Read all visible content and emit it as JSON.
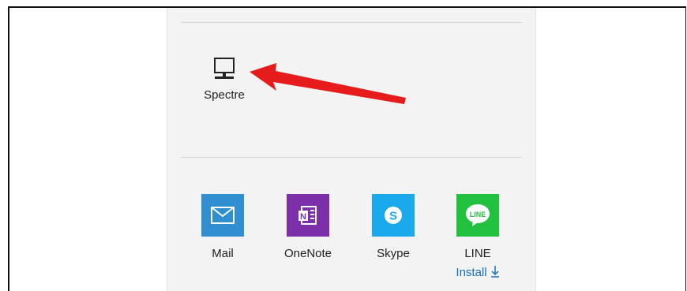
{
  "device": {
    "name": "Spectre",
    "icon": "desktop-computer-icon"
  },
  "apps": [
    {
      "name": "Mail",
      "icon": "mail-icon",
      "color": "#2f8fd1"
    },
    {
      "name": "OneNote",
      "icon": "onenote-icon",
      "color": "#7b2fa8"
    },
    {
      "name": "Skype",
      "icon": "skype-icon",
      "color": "#1aa9eb"
    },
    {
      "name": "LINE",
      "icon": "line-icon",
      "color": "#21c03f",
      "action_label": "Install"
    }
  ],
  "colors": {
    "annotation_arrow": "#e61b1b",
    "link": "#1a6fb5",
    "panel_bg": "#f3f3f3"
  }
}
